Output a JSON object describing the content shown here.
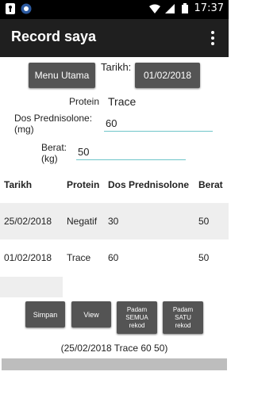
{
  "status_bar": {
    "time": "17:37",
    "left_icons": [
      "keyhole-icon",
      "app-icon"
    ],
    "right_icons": [
      "wifi-icon",
      "signal-icon",
      "battery-icon"
    ]
  },
  "app_bar": {
    "title": "Record saya",
    "menu_icon": "overflow-menu-icon"
  },
  "form": {
    "menu_utama_label": "Menu Utama",
    "tarikh_label": "Tarikh:",
    "tarikh_value": "01/02/2018",
    "protein_label": "Protein",
    "protein_value": "Trace",
    "dos_label_line1": "Dos Prednisolone:",
    "dos_label_line2": "(mg)",
    "dos_value": "60",
    "berat_label_line1": "Berat:",
    "berat_label_line2": "(kg)",
    "berat_value": "50"
  },
  "table": {
    "headers": [
      "Tarikh",
      "Protein",
      "Dos Prednisolone",
      "Berat"
    ],
    "rows": [
      [
        "25/02/2018",
        "Negatif",
        "30",
        "50"
      ],
      [
        "01/02/2018",
        "Trace",
        "60",
        "50"
      ]
    ]
  },
  "actions": {
    "simpan": "Simpan",
    "view": "View",
    "padam_semua_l1": "Padam",
    "padam_semua_l2": "SEMUA",
    "padam_semua_l3": "rekod",
    "padam_satu_l1": "Padam",
    "padam_satu_l2": "SATU",
    "padam_satu_l3": "rekod"
  },
  "result_text": "(25/02/2018 Trace 60 50)",
  "colors": {
    "status_bar": "#000000",
    "app_bar": "#1f1f1f",
    "button": "#545454",
    "input_underline": "#6fc5c9",
    "row_shade": "#eeeeee"
  }
}
